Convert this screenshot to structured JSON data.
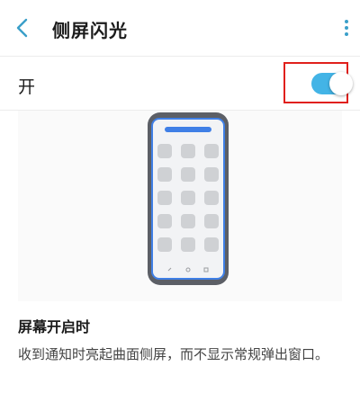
{
  "header": {
    "title": "侧屏闪光",
    "back_icon": "chevron-left-icon",
    "more_icon": "more-vertical-icon"
  },
  "toggle": {
    "label": "开",
    "state": "on"
  },
  "section": {
    "title": "屏幕开启时",
    "description": "收到通知时亮起曲面侧屏，而不显示常规弹出窗口。"
  },
  "colors": {
    "accent": "#43b4e6",
    "icon_accent": "#3a9fc9",
    "highlight": "#e0201c",
    "edge_glow": "#3f7fe6"
  }
}
